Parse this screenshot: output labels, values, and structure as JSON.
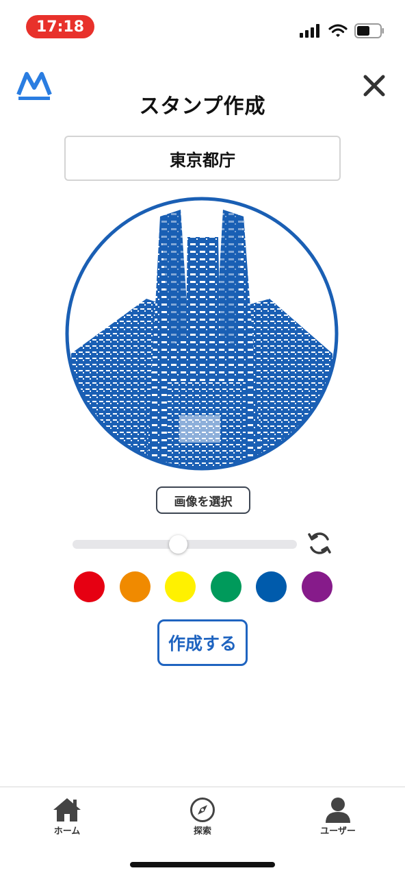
{
  "status_bar": {
    "time": "17:18",
    "time_pill_color": "#e8312b",
    "icons": [
      "cellular-signal-icon",
      "wifi-icon",
      "battery-icon"
    ]
  },
  "header": {
    "logo": "app-logo-icon",
    "title": "スタンプ作成",
    "close_icon": "close-icon"
  },
  "stamp_name": {
    "value": "東京都庁"
  },
  "stamp_preview": {
    "subject": "tower-building-stamp-image",
    "color": "#1a5fb4"
  },
  "select_image_button": {
    "label": "画像を選択"
  },
  "threshold_slider": {
    "value": 0.47
  },
  "rotate_button": {
    "icon": "rotate-icon"
  },
  "colors": [
    {
      "name": "red",
      "hex": "#e60012"
    },
    {
      "name": "orange",
      "hex": "#f08a00"
    },
    {
      "name": "yellow",
      "hex": "#fff100"
    },
    {
      "name": "green",
      "hex": "#009a5b"
    },
    {
      "name": "blue",
      "hex": "#005bac"
    },
    {
      "name": "purple",
      "hex": "#861b8a"
    }
  ],
  "create_button": {
    "label": "作成する",
    "color": "#1f64c0"
  },
  "tabbar": {
    "items": [
      {
        "label": "ホーム",
        "icon": "home-icon"
      },
      {
        "label": "探索",
        "icon": "compass-icon"
      },
      {
        "label": "ユーザー",
        "icon": "user-icon"
      }
    ]
  }
}
